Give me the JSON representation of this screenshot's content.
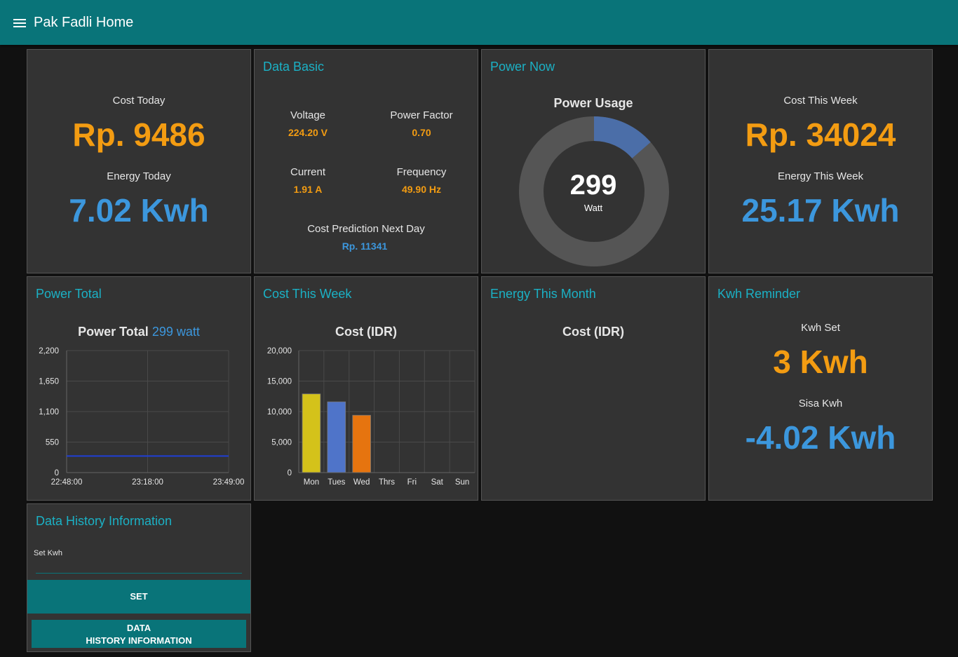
{
  "app": {
    "title": "Pak Fadli Home"
  },
  "cost_today": {
    "cost_label": "Cost Today",
    "cost_value": "Rp. 9486",
    "energy_label": "Energy Today",
    "energy_value": "7.02 Kwh"
  },
  "data_basic": {
    "title": "Data Basic",
    "voltage_label": "Voltage",
    "voltage_value": "224.20 V",
    "pf_label": "Power Factor",
    "pf_value": "0.70",
    "current_label": "Current",
    "current_value": "1.91 A",
    "freq_label": "Frequency",
    "freq_value": "49.90 Hz",
    "prediction_label": "Cost Prediction Next Day",
    "prediction_value": "Rp. 11341"
  },
  "power_now": {
    "title": "Power Now",
    "chart_title": "Power Usage",
    "value": "299",
    "unit": "Watt",
    "fraction": 0.136
  },
  "cost_week": {
    "cost_label": "Cost This Week",
    "cost_value": "Rp. 34024",
    "energy_label": "Energy This Week",
    "energy_value": "25.17 Kwh"
  },
  "power_total": {
    "title": "Power Total",
    "chart_title": "Power Total",
    "chart_value": "299 watt"
  },
  "cost_week_chart": {
    "title": "Cost This Week",
    "chart_title": "Cost (IDR)"
  },
  "energy_month": {
    "title": "Energy This Month",
    "chart_title": "Cost (IDR)"
  },
  "kwh_reminder": {
    "title": "Kwh Reminder",
    "set_label": "Kwh Set",
    "set_value": "3 Kwh",
    "sisa_label": "Sisa Kwh",
    "sisa_value": "-4.02 Kwh"
  },
  "history": {
    "title": "Data History Information",
    "input_label": "Set Kwh",
    "input_value": "",
    "set_button": "SET",
    "history_button_line1": "DATA",
    "history_button_line2": "HISTORY INFORMATION"
  },
  "colors": {
    "accent": "#097479",
    "title": "#1bb1c5",
    "orange": "#f39c12",
    "blue": "#3c97dd",
    "gauge_fill": "#4b6ea8"
  },
  "chart_data": [
    {
      "type": "line",
      "x": [
        "22:48:00",
        "23:18:00",
        "23:49:00"
      ],
      "series": [
        {
          "values": [
            299,
            299,
            299
          ]
        }
      ],
      "yticks": [
        "0",
        "550",
        "1,100",
        "1,650",
        "2,200"
      ],
      "ylim": [
        0,
        2200
      ],
      "grid": true
    },
    {
      "type": "bar",
      "title": "Cost (IDR)",
      "categories": [
        "Mon",
        "Tues",
        "Wed",
        "Thrs",
        "Fri",
        "Sat",
        "Sun"
      ],
      "values": [
        12900,
        11600,
        9400,
        null,
        null,
        null,
        null
      ],
      "colors": [
        "#d4c21a",
        "#4f74c9",
        "#e6740f"
      ],
      "yticks": [
        "0",
        "5,000",
        "10,000",
        "15,000",
        "20,000"
      ],
      "ylim": [
        0,
        20000
      ],
      "grid": true
    }
  ]
}
